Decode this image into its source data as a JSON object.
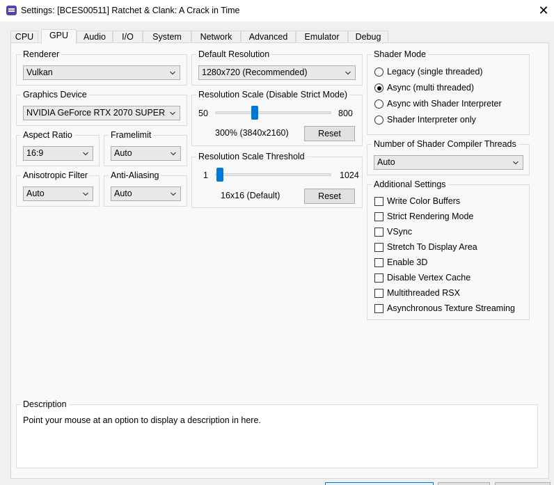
{
  "window": {
    "title": "Settings: [BCES00511] Ratchet & Clank: A Crack in Time",
    "close_glyph": "✕"
  },
  "tabs": [
    "CPU",
    "GPU",
    "Audio",
    "I/O",
    "System",
    "Network",
    "Advanced",
    "Emulator",
    "Debug"
  ],
  "active_tab": "GPU",
  "renderer": {
    "title": "Renderer",
    "value": "Vulkan"
  },
  "graphics_device": {
    "title": "Graphics Device",
    "value": "NVIDIA GeForce RTX 2070 SUPER"
  },
  "aspect_ratio": {
    "title": "Aspect Ratio",
    "value": "16:9"
  },
  "framelimit": {
    "title": "Framelimit",
    "value": "Auto"
  },
  "anisotropic_filter": {
    "title": "Anisotropic Filter",
    "value": "Auto"
  },
  "anti_aliasing": {
    "title": "Anti-Aliasing",
    "value": "Auto"
  },
  "default_resolution": {
    "title": "Default Resolution",
    "value": "1280x720 (Recommended)"
  },
  "resolution_scale": {
    "title": "Resolution Scale (Disable Strict Mode)",
    "min_label": "50",
    "max_label": "800",
    "value_text": "300% (3840x2160)",
    "reset_label": "Reset",
    "min": 50,
    "max": 800,
    "value": 300
  },
  "resolution_scale_threshold": {
    "title": "Resolution Scale Threshold",
    "min_label": "1",
    "max_label": "1024",
    "value_text": "16x16 (Default)",
    "reset_label": "Reset",
    "min": 1,
    "max": 1024,
    "value": 16
  },
  "shader_mode": {
    "title": "Shader Mode",
    "options": [
      {
        "label": "Legacy (single threaded)",
        "checked": false
      },
      {
        "label": "Async (multi threaded)",
        "checked": true
      },
      {
        "label": "Async with Shader Interpreter",
        "checked": false
      },
      {
        "label": "Shader Interpreter only",
        "checked": false
      }
    ]
  },
  "shader_threads": {
    "title": "Number of Shader Compiler Threads",
    "value": "Auto"
  },
  "additional_settings": {
    "title": "Additional Settings",
    "items": [
      {
        "label": "Write Color Buffers",
        "checked": false
      },
      {
        "label": "Strict Rendering Mode",
        "checked": false
      },
      {
        "label": "VSync",
        "checked": false
      },
      {
        "label": "Stretch To Display Area",
        "checked": false
      },
      {
        "label": "Enable 3D",
        "checked": false
      },
      {
        "label": "Disable Vertex Cache",
        "checked": false
      },
      {
        "label": "Multithreaded RSX",
        "checked": false
      },
      {
        "label": "Asynchronous Texture Streaming",
        "checked": false
      }
    ]
  },
  "description": {
    "title": "Description",
    "text": "Point your mouse at an option to display a description in here."
  },
  "colors": {
    "accent": "#0078d7",
    "panel": "#f9f9f9",
    "window": "#f0f0f0"
  },
  "icons": {
    "app": "rpcs3-app-icon",
    "chevron": "chevron-down-icon",
    "close": "close-icon"
  }
}
